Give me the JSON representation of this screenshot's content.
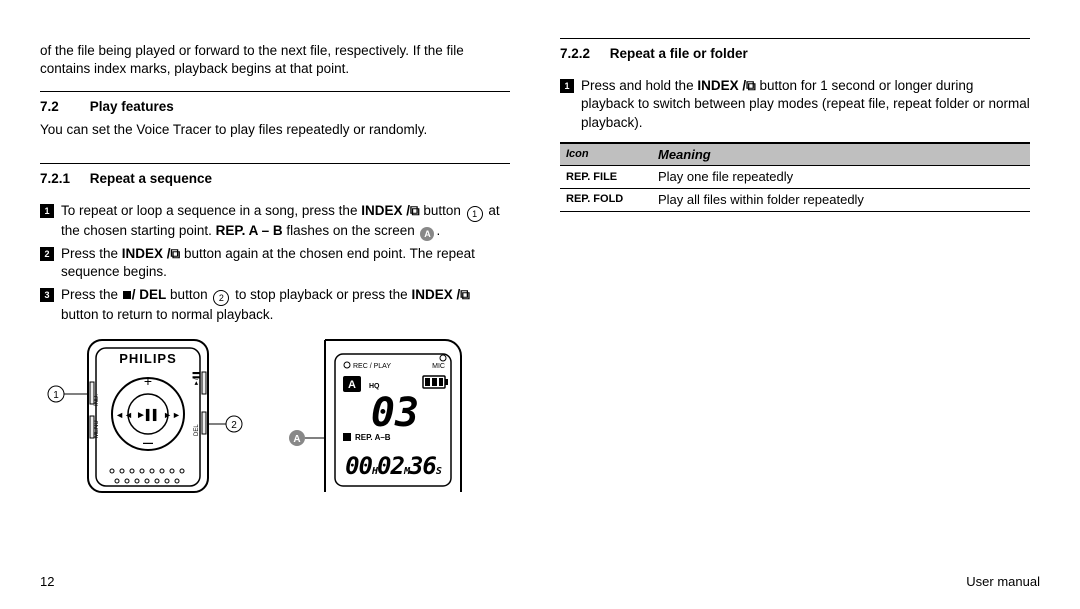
{
  "text": {
    "carryover_1": "of the file being played or forward to the next file, respectively. If the file contains index marks, playback begins at that point.",
    "sec_7_2_num": "7.2",
    "sec_7_2_title": "Play features",
    "sec_7_2_body": "You can set the Voice Tracer to play files repeatedly or randomly.",
    "sec_7_2_1_num": "7.2.1",
    "sec_7_2_1_title": "Repeat a sequence",
    "step1a": "To repeat or loop a sequence in a song, press the ",
    "btn_index": "INDEX /",
    "step1b": " button ",
    "step1c": " at the chosen starting point. ",
    "rep_ab": "REP. A – B",
    "step1d": " flashes on the screen ",
    "step2a": "Press the ",
    "step2b": " button again at the chosen end point. The repeat sequence begins.",
    "step3a": "Press the ",
    "btn_del": "/ DEL",
    "step3b": " button ",
    "step3c": " to stop playback or press the ",
    "step3d": " button to return to normal playback.",
    "sec_7_2_2_num": "7.2.2",
    "sec_7_2_2_title": "Repeat a file or folder",
    "r_step1a": "Press and hold the ",
    "r_step1b": " button for 1 second or longer during playback to switch between play modes (repeat file, repeat folder or normal playback).",
    "table": {
      "head_icon": "Icon",
      "head_meaning": "Meaning",
      "rows": [
        {
          "icon": "REP. FILE",
          "meaning": "Play one file repeatedly"
        },
        {
          "icon": "REP. FOLD",
          "meaning": "Play all files within folder repeatedly"
        }
      ]
    },
    "callout_1": "1",
    "callout_2": "2",
    "callout_A": "A",
    "page_number": "12",
    "doc_title": "User manual",
    "device_brand": "PHILIPS",
    "lcd": {
      "rec_play": "REC / PLAY",
      "mic": "MIC",
      "letter": "A",
      "hq": "HQ",
      "track": "03",
      "repab": "REP. A–B",
      "time": "00H02M36S"
    }
  }
}
